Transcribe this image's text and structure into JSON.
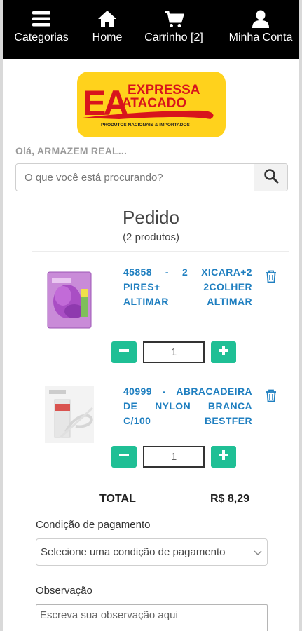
{
  "nav": {
    "categories_label": "Categorias",
    "home_label": "Home",
    "cart_label": "Carrinho [2]",
    "account_label": "Minha Conta"
  },
  "logo": {
    "letters": "EA",
    "line1": "EXPRESSA",
    "line2": "ATACADO",
    "tagline": "PRODUTOS NACIONAIS & IMPORTADOS"
  },
  "greeting": "Olá, ARMAZEM REAL...",
  "search": {
    "placeholder": "O que você está procurando?"
  },
  "order": {
    "title": "Pedido",
    "count": "(2 produtos)",
    "items": [
      {
        "name_lines": [
          "45858 - 2 XICARA+2",
          "PIRES+ 2COLHER",
          "ALTIMAR ALTIMAR"
        ],
        "quantity": "1"
      },
      {
        "name_lines": [
          "40999 - ABRACADEIRA",
          "DE NYLON BRANCA",
          "C/100 BESTFER"
        ],
        "quantity": "1"
      }
    ]
  },
  "total": {
    "label": "TOTAL",
    "value": "R$ 8,29"
  },
  "payment": {
    "label": "Condição de pagamento",
    "selected": "Selecione uma condição de pagamento"
  },
  "notes": {
    "label": "Observação",
    "placeholder": "Escreva sua observação aqui"
  },
  "colors": {
    "nav_bg": "#000000",
    "accent_green": "#1fbf95",
    "link_blue": "#1f7fc0",
    "logo_yellow": "#ffd21c",
    "logo_red": "#d8141c"
  }
}
